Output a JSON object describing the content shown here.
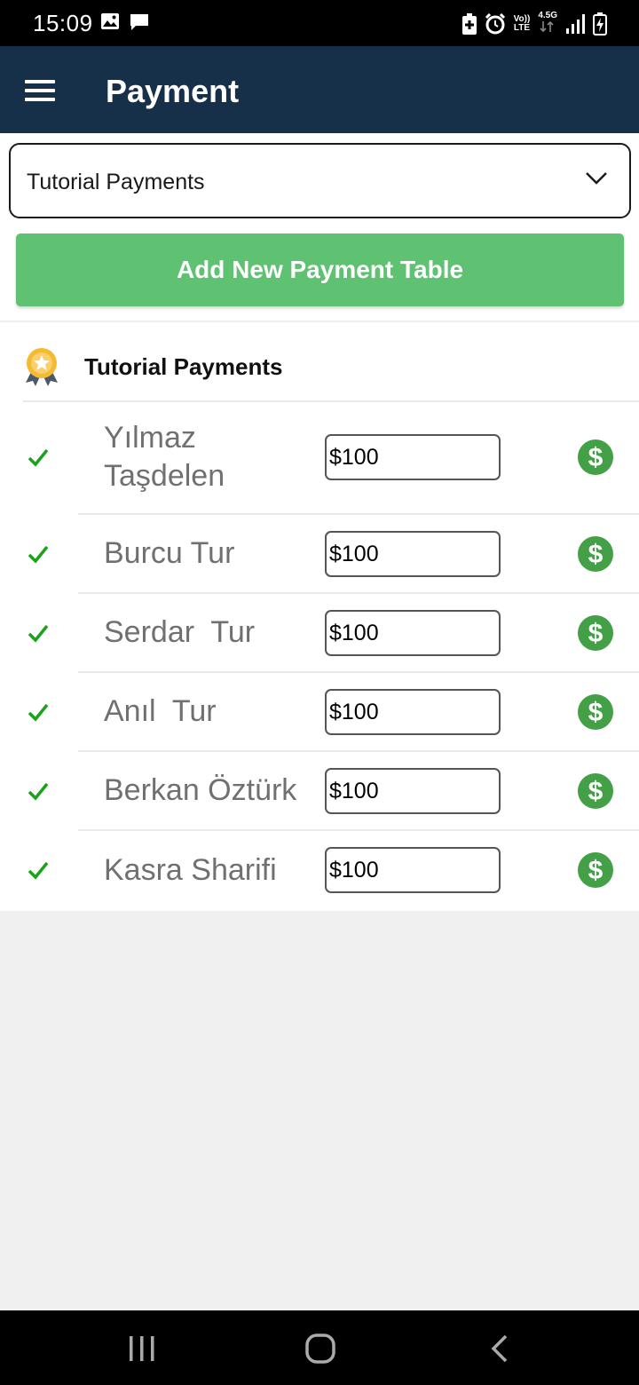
{
  "status_bar": {
    "time": "15:09",
    "left_icons": [
      "image-icon",
      "message-icon"
    ],
    "right_icons": [
      "battery-saver-icon",
      "alarm-icon",
      "volte-icon",
      "network-4g-icon",
      "signal-icon",
      "battery-charging-icon"
    ],
    "volte_top": "Vo))",
    "volte_bottom": "LTE",
    "network_label": "4.5G"
  },
  "app_bar": {
    "title": "Payment",
    "menu_icon": "hamburger-menu-icon"
  },
  "dropdown": {
    "selected": "Tutorial Payments",
    "icon": "chevron-down-icon"
  },
  "add_button": {
    "label": "Add New Payment Table",
    "color": "#5ec272"
  },
  "payment_list": {
    "title": "Tutorial Payments",
    "icon": "award-medal-icon",
    "rows": [
      {
        "name": "Yılmaz\nTaşdelen",
        "amount": "$100",
        "checked": true
      },
      {
        "name": "Burcu Tur",
        "amount": "$100",
        "checked": true
      },
      {
        "name": "Serdar  Tur",
        "amount": "$100",
        "checked": true
      },
      {
        "name": "Anıl  Tur",
        "amount": "$100",
        "checked": true
      },
      {
        "name": "Berkan Öztürk",
        "amount": "$100",
        "checked": true
      },
      {
        "name": "Kasra Sharifi",
        "amount": "$100",
        "checked": true
      }
    ]
  },
  "colors": {
    "app_bar": "#17304a",
    "accent_green": "#5ec272",
    "check_green": "#1aa31a",
    "pay_icon_green": "#43a047"
  },
  "nav_bar": {
    "buttons": [
      "recent-apps-icon",
      "home-icon",
      "back-icon"
    ]
  }
}
